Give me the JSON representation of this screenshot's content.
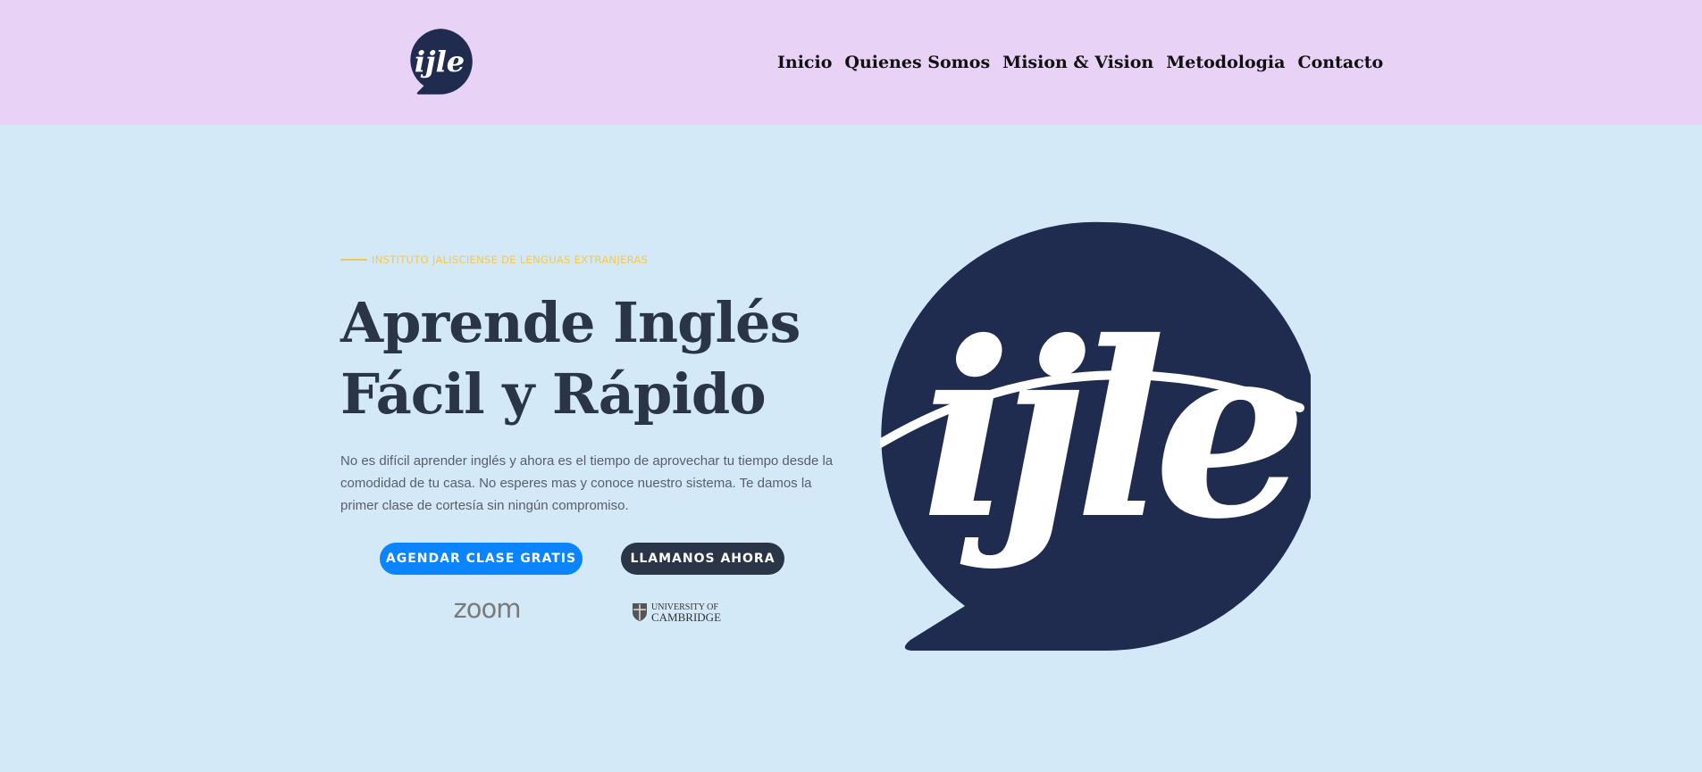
{
  "colors": {
    "header_bg": "#e8d3f6",
    "hero_bg": "#d4e9f8",
    "brand_navy": "#1f2b4f",
    "accent_yellow": "#f2c94c",
    "button_blue": "#0a84ff",
    "button_dark": "#2a3547",
    "heading": "#2a3547"
  },
  "header": {
    "logo": {
      "text": "ijle",
      "icon": "speech-bubble-logo-icon"
    },
    "nav": [
      {
        "label": "Inicio"
      },
      {
        "label": "Quienes Somos"
      },
      {
        "label": "Mision & Vision"
      },
      {
        "label": "Metodologia"
      },
      {
        "label": "Contacto"
      }
    ]
  },
  "hero": {
    "eyebrow": "INSTITUTO JALISCIENSE DE LENGUAS EXTRANJERAS",
    "title_line1": "Aprende Inglés",
    "title_line2": "Fácil y Rápido",
    "description": "No es difícil aprender inglés y ahora es el tiempo de aprovechar tu tiempo desde la comodidad de tu casa. No esperes mas y conoce nuestro sistema. Te damos la primer clase de cortesía sin ningún compromiso.",
    "buttons": {
      "primary": "AGENDAR CLASE GRATIS",
      "secondary": "LLAMANOS AHORA"
    },
    "partners": {
      "zoom": "zoom",
      "cambridge_line1": "UNIVERSITY OF",
      "cambridge_line2": "CAMBRIDGE"
    },
    "big_logo_text": "ijle"
  }
}
